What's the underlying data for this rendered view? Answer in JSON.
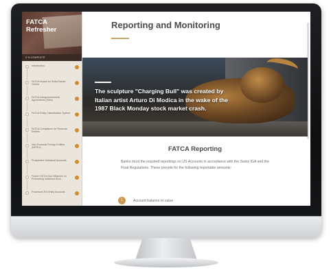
{
  "sidebar": {
    "title_line1": "FATCA",
    "title_line2": "Refresher",
    "progress_label": "0 % COMPLETE",
    "items": [
      {
        "label": "Introduction"
      },
      {
        "label": "FATCA Impact on Swiss Banks' Clients"
      },
      {
        "label": "FATCA Intergovernmental Agreements (IGAs)"
      },
      {
        "label": "FATCA Entity Classification System"
      },
      {
        "label": "FATCA Compliance for Financial Entities"
      },
      {
        "label": "Non-Financial Foreign Entities (NFFEs)"
      },
      {
        "label": "Prospective Individual Accounts"
      },
      {
        "label": "Future FATCA Due Diligence on Preexisting Individual Acco..."
      },
      {
        "label": "Processes For Entity Accounts"
      }
    ]
  },
  "main": {
    "title": "Reporting and Monitoring",
    "hero_caption": "The sculpture \"Charging Bull\" was created by Italian artist Arturo Di Modica in the wake of the 1987 Black Monday stock market crash.",
    "section_title": "FATCA Reporting",
    "section_body": "Banks must the required reportings on US Accounts in accordance with the Swiss IGA and the Final Regulations. These provide for the following reportable amounts:",
    "list_number": "1",
    "list_item": "Account balance or value"
  },
  "colors": {
    "accent": "#c9974f",
    "status_dot": "#d28a2a",
    "sidebar_bg": "#eae5dd"
  }
}
